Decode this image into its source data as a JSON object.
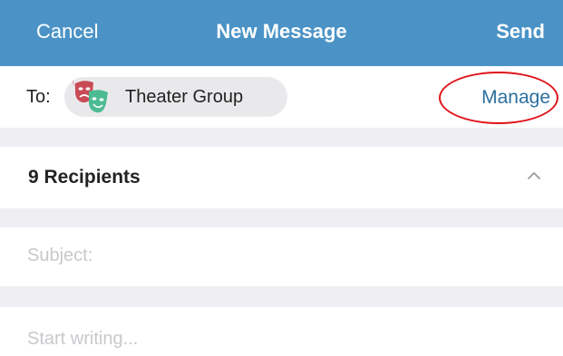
{
  "navbar": {
    "cancel_label": "Cancel",
    "title": "New Message",
    "send_label": "Send",
    "background_color": "#4b93c6"
  },
  "to_row": {
    "label": "To:",
    "recipient_chip": {
      "label": "Theater Group",
      "avatar_icon": "theater-masks-icon"
    },
    "manage_label": "Manage",
    "highlight_color": "#e0141b"
  },
  "recipients": {
    "label": "9 Recipients",
    "toggle_icon": "chevron-up-icon"
  },
  "subject": {
    "placeholder": "Subject:",
    "value": ""
  },
  "body": {
    "placeholder": "Start writing...",
    "value": ""
  }
}
